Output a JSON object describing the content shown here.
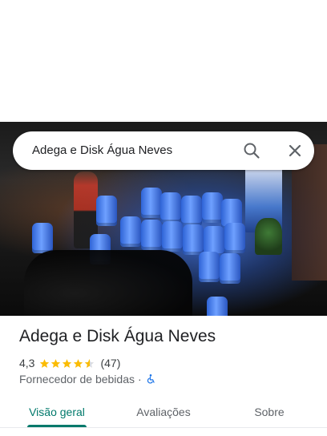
{
  "search": {
    "query": "Adega e Disk Água Neves",
    "search_icon": "search-icon",
    "close_icon": "close-icon"
  },
  "hero": {
    "image": "storefront photo of water jugs at night"
  },
  "place": {
    "title": "Adega e Disk Água Neves",
    "rating": "4,3",
    "rating_stars": 4.3,
    "reviews": "(47)",
    "category": "Fornecedor de bebidas",
    "separator": "·",
    "accessibility_icon": "wheelchair-icon"
  },
  "tabs": [
    {
      "label": "Visão geral",
      "active": true
    },
    {
      "label": "Avaliações",
      "active": false
    },
    {
      "label": "Sobre",
      "active": false
    }
  ],
  "colors": {
    "accent": "#00796b",
    "star": "#fbbc04",
    "access": "#1a73e8"
  }
}
